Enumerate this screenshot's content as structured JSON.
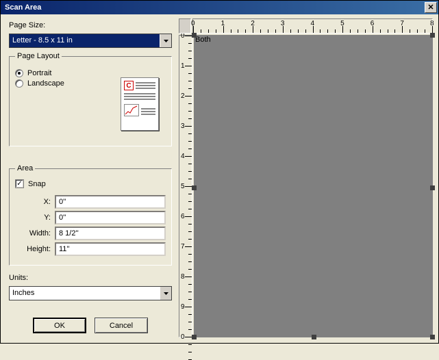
{
  "title": "Scan Area",
  "page_size": {
    "label": "Page Size:",
    "value": "Letter - 8.5 x 11 in"
  },
  "page_layout": {
    "legend": "Page Layout",
    "portrait": "Portrait",
    "landscape": "Landscape",
    "selected": "portrait"
  },
  "area": {
    "legend": "Area",
    "snap_label": "Snap",
    "snap_checked": true,
    "x_label": "X:",
    "y_label": "Y:",
    "width_label": "Width:",
    "height_label": "Height:",
    "x": "0''",
    "y": "0''",
    "width": "8 1/2''",
    "height": "11''"
  },
  "units": {
    "label": "Units:",
    "value": "Inches"
  },
  "buttons": {
    "ok": "OK",
    "cancel": "Cancel"
  },
  "preview": {
    "both_label": "Both",
    "h_ticks": [
      "0",
      "1",
      "2",
      "3",
      "4",
      "5",
      "6",
      "7",
      "8"
    ],
    "v_ticks": [
      "0",
      "1",
      "2",
      "3",
      "4",
      "5",
      "6",
      "7",
      "8",
      "9",
      "0"
    ]
  }
}
